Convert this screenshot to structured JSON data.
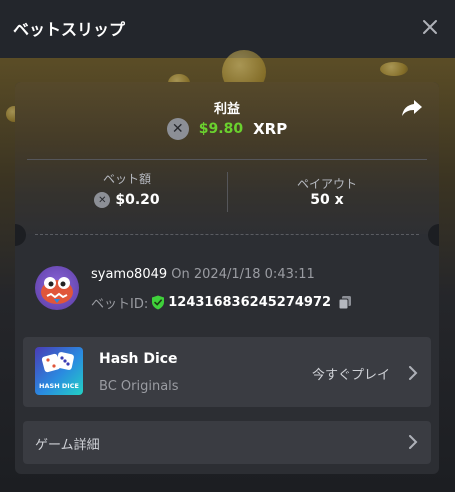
{
  "header": {
    "title": "ベットスリップ"
  },
  "summary": {
    "profit_label": "利益",
    "profit_amount": "$9.80",
    "profit_currency": "XRP",
    "bet_amount_label": "ベット額",
    "bet_amount_value": "$0.20",
    "payout_label": "ペイアウト",
    "payout_value": "50 x"
  },
  "bet": {
    "username": "syamo8049",
    "datetime": " On 2024/1/18 0:43:11",
    "bet_id_label": "ベットID:",
    "bet_id_value": "124316836245274972"
  },
  "game": {
    "name": "Hash Dice",
    "provider": "BC Originals",
    "play_label": "今すぐプレイ",
    "thumb_text": "HASH DICE"
  },
  "details": {
    "label": "ゲーム詳細"
  },
  "colors": {
    "profit_green": "#6ad12e",
    "shield_green": "#3fd13b",
    "background": "#1c1e22"
  },
  "icons": [
    "close-icon",
    "share-icon",
    "xrp-coin-icon",
    "verified-shield-icon",
    "copy-icon",
    "chevron-right-icon"
  ]
}
